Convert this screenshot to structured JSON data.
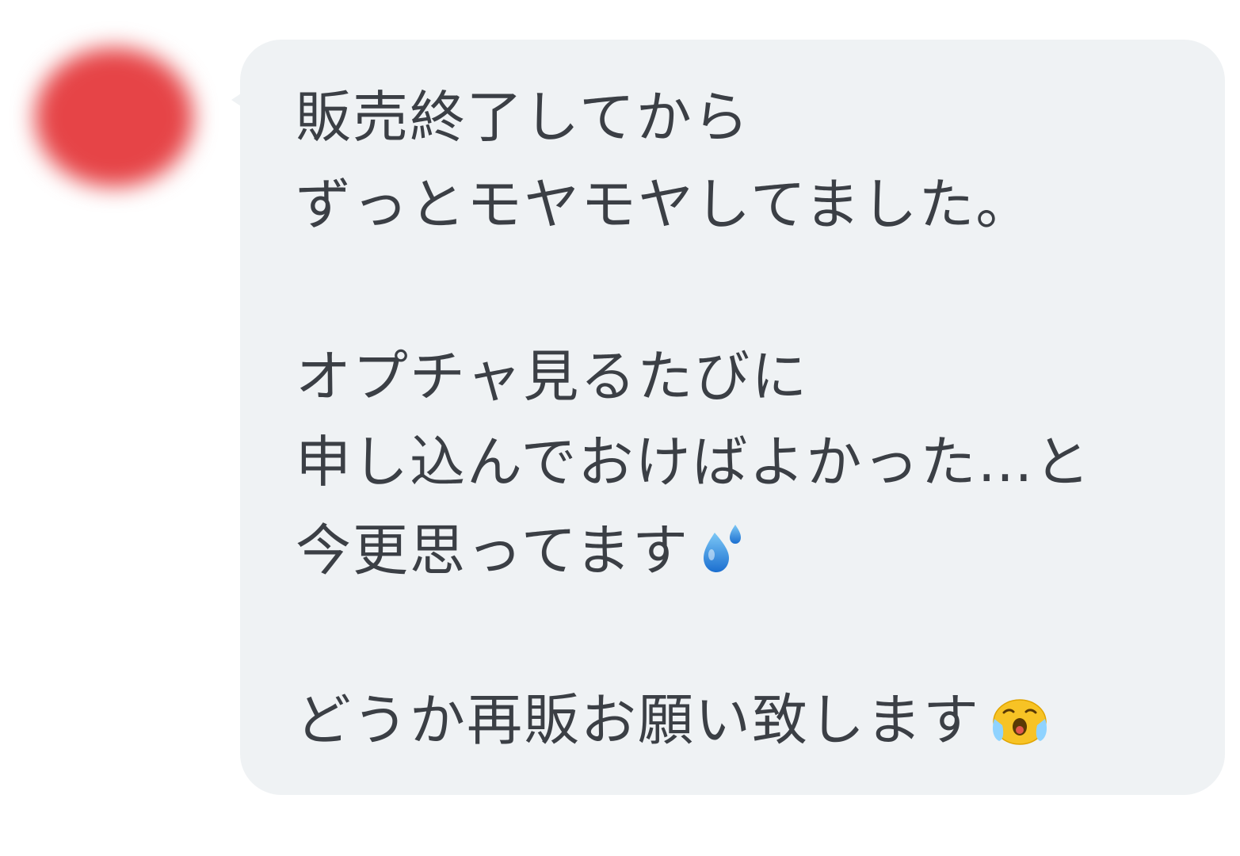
{
  "message": {
    "lines": [
      "販売終了してから",
      "ずっとモヤモヤしてました。",
      "",
      "オプチャ見るたびに",
      "申し込んでおけばよかった…と",
      "今更思ってます",
      "",
      "どうか再販お願い致します"
    ],
    "emojis": {
      "sweat_drop": "💦",
      "crying_face": "😭"
    },
    "colors": {
      "bubble": "#eff2f4",
      "text": "#3b3f45",
      "avatar": "#e64447"
    }
  }
}
